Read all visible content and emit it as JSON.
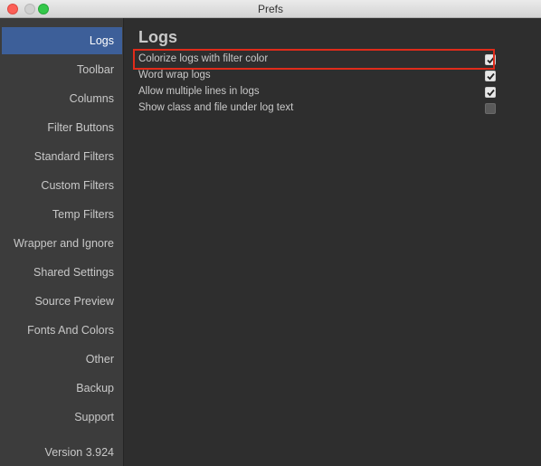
{
  "window": {
    "title": "Prefs"
  },
  "sidebar": {
    "items": [
      {
        "label": "Logs",
        "active": true
      },
      {
        "label": "Toolbar"
      },
      {
        "label": "Columns"
      },
      {
        "label": "Filter Buttons"
      },
      {
        "label": "Standard Filters"
      },
      {
        "label": "Custom Filters"
      },
      {
        "label": "Temp Filters"
      },
      {
        "label": "Wrapper and Ignore"
      },
      {
        "label": "Shared Settings"
      },
      {
        "label": "Source Preview"
      },
      {
        "label": "Fonts And Colors"
      },
      {
        "label": "Other"
      },
      {
        "label": "Backup"
      },
      {
        "label": "Support"
      }
    ],
    "version": "Version 3.924"
  },
  "main": {
    "heading": "Logs",
    "options": [
      {
        "label": "Colorize logs with filter color",
        "checked": true,
        "highlighted": true
      },
      {
        "label": "Word wrap logs",
        "checked": true
      },
      {
        "label": "Allow multiple lines in logs",
        "checked": true
      },
      {
        "label": "Show class and file under log text",
        "checked": false
      }
    ]
  },
  "colors": {
    "accent": "#3d5f99",
    "highlight_box": "#e02b1a"
  }
}
